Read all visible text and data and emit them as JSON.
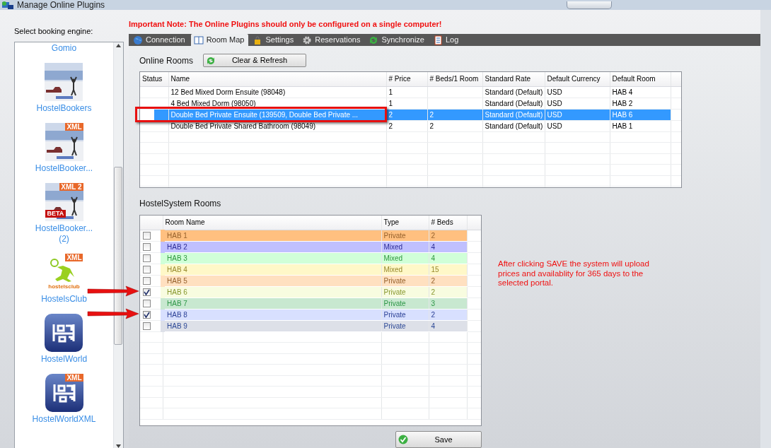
{
  "window": {
    "title": "Manage Online Plugins"
  },
  "important_note": "Important Note:  The Online Plugins should only be configured on a single computer!",
  "sidebar": {
    "label": "Select booking engine:",
    "items": [
      {
        "label": "Gomio",
        "kind": "text"
      },
      {
        "label": "HostelBookers"
      },
      {
        "label": "HostelBooker...",
        "badge": "XML"
      },
      {
        "label": "HostelBooker...",
        "sublabel": "(2)",
        "badge": "XML 2",
        "corner_badge": "BETA"
      },
      {
        "label": "HostelsClub",
        "kind": "club",
        "badge": "XML",
        "logo_text": "hostelsclub"
      },
      {
        "label": "HostelWorld",
        "kind": "bed"
      },
      {
        "label": "HostelWorldXML",
        "kind": "bed",
        "badge": "XML"
      }
    ]
  },
  "tabs": [
    {
      "label": "Connection",
      "selected": false
    },
    {
      "label": "Room Map",
      "selected": true
    },
    {
      "label": "Settings",
      "selected": false
    },
    {
      "label": "Reservations",
      "selected": false
    },
    {
      "label": "Synchronize",
      "selected": false
    },
    {
      "label": "Log",
      "selected": false
    }
  ],
  "online_rooms": {
    "title": "Online Rooms",
    "refresh_button": "Clear & Refresh",
    "columns": [
      "Status",
      "Name",
      "# Price",
      "# Beds/1 Room",
      "Standard Rate",
      "Default Currency",
      "Default Room"
    ],
    "rows": [
      {
        "cells": [
          "",
          "12 Bed Mixed Dorm Ensuite (98048)",
          "1",
          "",
          "Standard (Default)",
          "USD",
          "HAB 4"
        ],
        "selected": false,
        "highlighted": false
      },
      {
        "cells": [
          "",
          "4 Bed Mixed Dorm (98050)",
          "1",
          "",
          "Standard (Default)",
          "USD",
          "HAB 2"
        ],
        "selected": false,
        "highlighted": false
      },
      {
        "cells": [
          "",
          "Double Bed Private Ensuite (139509, Double Bed Private ...",
          "2",
          "2",
          "Standard (Default)",
          "USD",
          "HAB 6"
        ],
        "selected": true,
        "highlighted": true
      },
      {
        "cells": [
          "",
          "Double Bed Private Shared Bathroom (98049)",
          "2",
          "2",
          "Standard (Default)",
          "USD",
          "HAB 1"
        ],
        "selected": false,
        "highlighted": false
      }
    ]
  },
  "system_rooms": {
    "title": "HostelSystem Rooms",
    "columns": [
      "Room Name",
      "Type",
      "# Beds"
    ],
    "rows": [
      {
        "cells": [
          "HAB 1",
          "Private",
          "2"
        ],
        "checked": false,
        "color": "#ffc080",
        "arrow": false
      },
      {
        "cells": [
          "HAB 2",
          "Mixed",
          "4"
        ],
        "checked": false,
        "color": "#c0c0ff",
        "arrow": false
      },
      {
        "cells": [
          "HAB 3",
          "Mixed",
          "4"
        ],
        "checked": false,
        "color": "#d0ffd8",
        "arrow": false
      },
      {
        "cells": [
          "HAB 4",
          "Mixed",
          "15"
        ],
        "checked": false,
        "color": "#fff8c8",
        "arrow": false
      },
      {
        "cells": [
          "HAB 5",
          "Private",
          "2"
        ],
        "checked": false,
        "color": "#ffe0c0",
        "arrow": false
      },
      {
        "cells": [
          "HAB 6",
          "Private",
          "2"
        ],
        "checked": true,
        "color": "#f8fce0",
        "arrow": true
      },
      {
        "cells": [
          "HAB 7",
          "Private",
          "3"
        ],
        "checked": false,
        "color": "#c8e8d0",
        "arrow": false
      },
      {
        "cells": [
          "HAB 8",
          "Private",
          "2"
        ],
        "checked": true,
        "color": "#d8e0ff",
        "arrow": true
      },
      {
        "cells": [
          "HAB 9",
          "Private",
          "4"
        ],
        "checked": false,
        "color": "#dde0e8",
        "arrow": false
      }
    ]
  },
  "save_note": "After clicking SAVE the system will upload prices and availablity for 365 days to the selected portal.",
  "save_button": "Save"
}
